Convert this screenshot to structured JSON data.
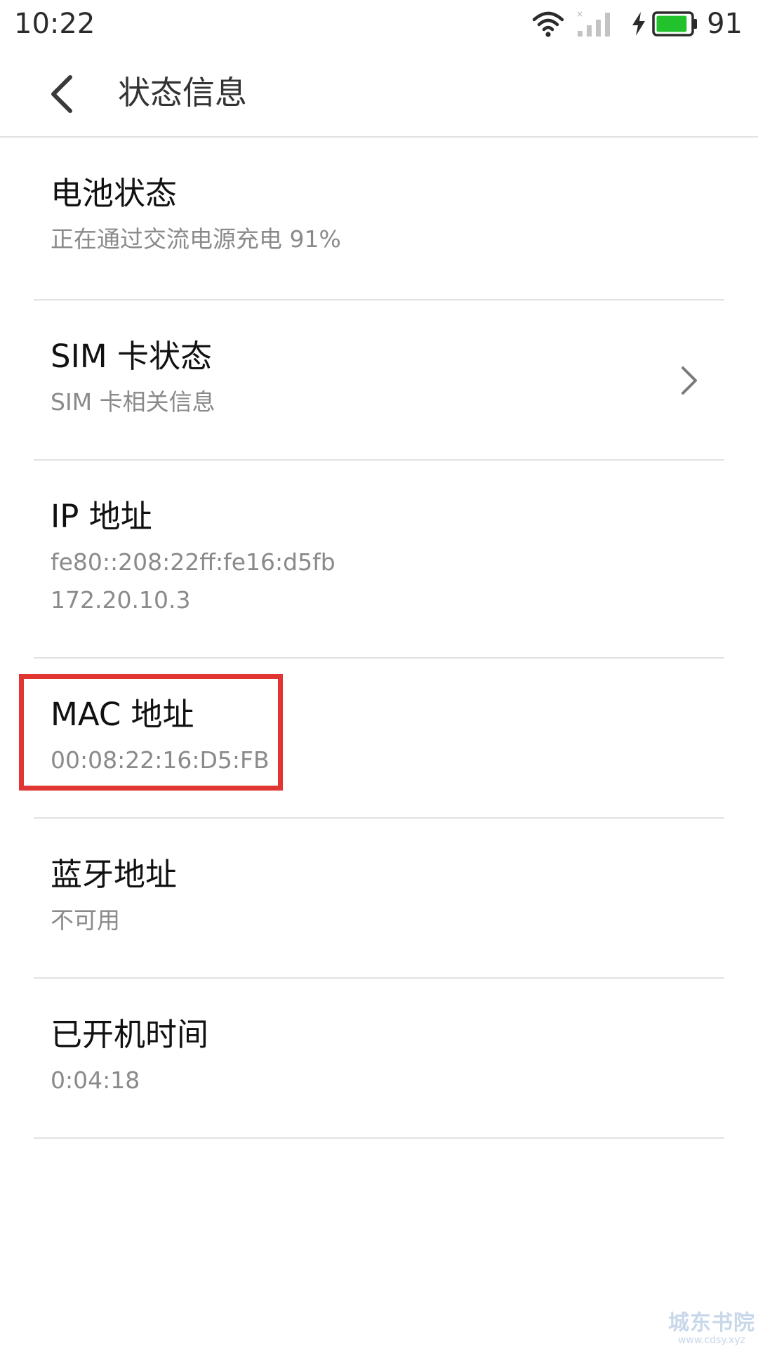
{
  "status_bar": {
    "time": "10:22",
    "battery_level": "91"
  },
  "header": {
    "title": "状态信息"
  },
  "items": [
    {
      "title": "电池状态",
      "lines": [
        "正在通过交流电源充电 91%"
      ]
    },
    {
      "title": "SIM 卡状态",
      "lines": [
        "SIM 卡相关信息"
      ]
    },
    {
      "title": "IP 地址",
      "lines": [
        "fe80::208:22ff:fe16:d5fb",
        "172.20.10.3"
      ]
    },
    {
      "title": "MAC 地址",
      "lines": [
        "00:08:22:16:D5:FB"
      ]
    },
    {
      "title": "蓝牙地址",
      "lines": [
        "不可用"
      ]
    },
    {
      "title": "已开机时间",
      "lines": [
        "0:04:18"
      ]
    }
  ],
  "watermark": {
    "text": "城东书院",
    "sub": "www.cdsy.xyz"
  },
  "colors": {
    "highlight": "#e03530",
    "battery_fill": "#22c22c",
    "divider": "#e2e2e2",
    "secondary_text": "#8a8a8a"
  },
  "icons": {
    "back": "chevron-left-icon",
    "sim_chevron": "chevron-right-icon",
    "wifi": "wifi-icon",
    "signal": "signal-icon",
    "charging": "charging-icon",
    "battery": "battery-icon"
  }
}
